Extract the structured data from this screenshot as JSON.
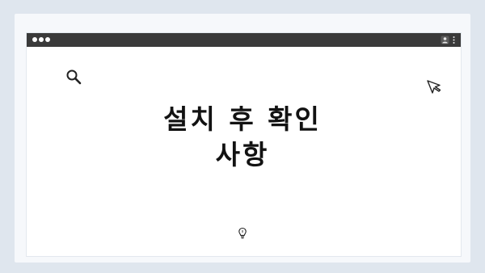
{
  "pager": {
    "count": 4
  },
  "window": {
    "titlebar_buttons": 3,
    "colors": {
      "titlebar": "#3a3a3a",
      "content": "#ffffff",
      "backdrop": "#dfe6ee"
    },
    "icons": [
      "user-icon",
      "kebab-menu-icon"
    ]
  },
  "content": {
    "title_line1": "설치 후 확인",
    "title_line2": "사항",
    "icons": [
      "search-icon",
      "cursor-pointer-icon",
      "lightbulb-icon"
    ]
  }
}
